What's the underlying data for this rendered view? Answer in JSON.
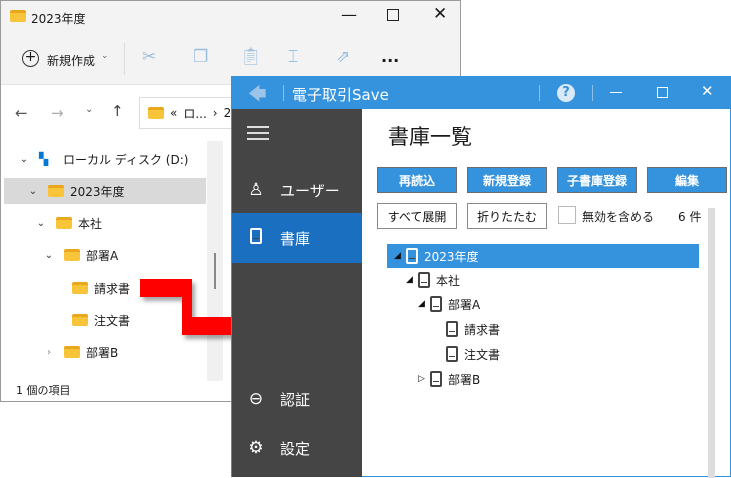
{
  "explorer": {
    "title": "2023年度",
    "toolbar": {
      "new_label": "新規作成",
      "more": "..."
    },
    "address": {
      "prefix": "«",
      "crumb": "ロ...",
      "sep": "›",
      "next": "2"
    },
    "tree": [
      {
        "label": "ローカル ディスク (D:)",
        "expanded": true
      },
      {
        "label": "2023年度",
        "expanded": true,
        "selected": true
      },
      {
        "label": "本社",
        "expanded": true
      },
      {
        "label": "部署A",
        "expanded": true
      },
      {
        "label": "請求書"
      },
      {
        "label": "注文書"
      },
      {
        "label": "部署B",
        "expanded": false
      }
    ],
    "status": "1 個の項目"
  },
  "app": {
    "title": "電子取引Save",
    "sidebar": [
      {
        "label": "ユーザー",
        "icon": "user-check-icon"
      },
      {
        "label": "書庫",
        "icon": "book-icon",
        "selected": true
      },
      {
        "label": "認証",
        "icon": "login-icon"
      },
      {
        "label": "設定",
        "icon": "gear-icon"
      }
    ],
    "page_title": "書庫一覧",
    "buttons": {
      "reload": "再読込",
      "new": "新規登録",
      "child": "子書庫登録",
      "edit": "編集",
      "expand_all": "すべて展開",
      "collapse": "折りたたむ"
    },
    "include_disabled": {
      "label": "無効を含める",
      "checked": false
    },
    "count": "6 件",
    "tree": [
      {
        "label": "2023年度",
        "expanded": true,
        "selected": true
      },
      {
        "label": "本社",
        "expanded": true
      },
      {
        "label": "部署A",
        "expanded": true
      },
      {
        "label": "請求書"
      },
      {
        "label": "注文書"
      },
      {
        "label": "部署B",
        "expanded": false
      }
    ]
  },
  "colors": {
    "accent": "#3592dd",
    "sidebar": "#454545",
    "sidebar_selected": "#1a6fc0",
    "arrow": "#ff0000"
  }
}
